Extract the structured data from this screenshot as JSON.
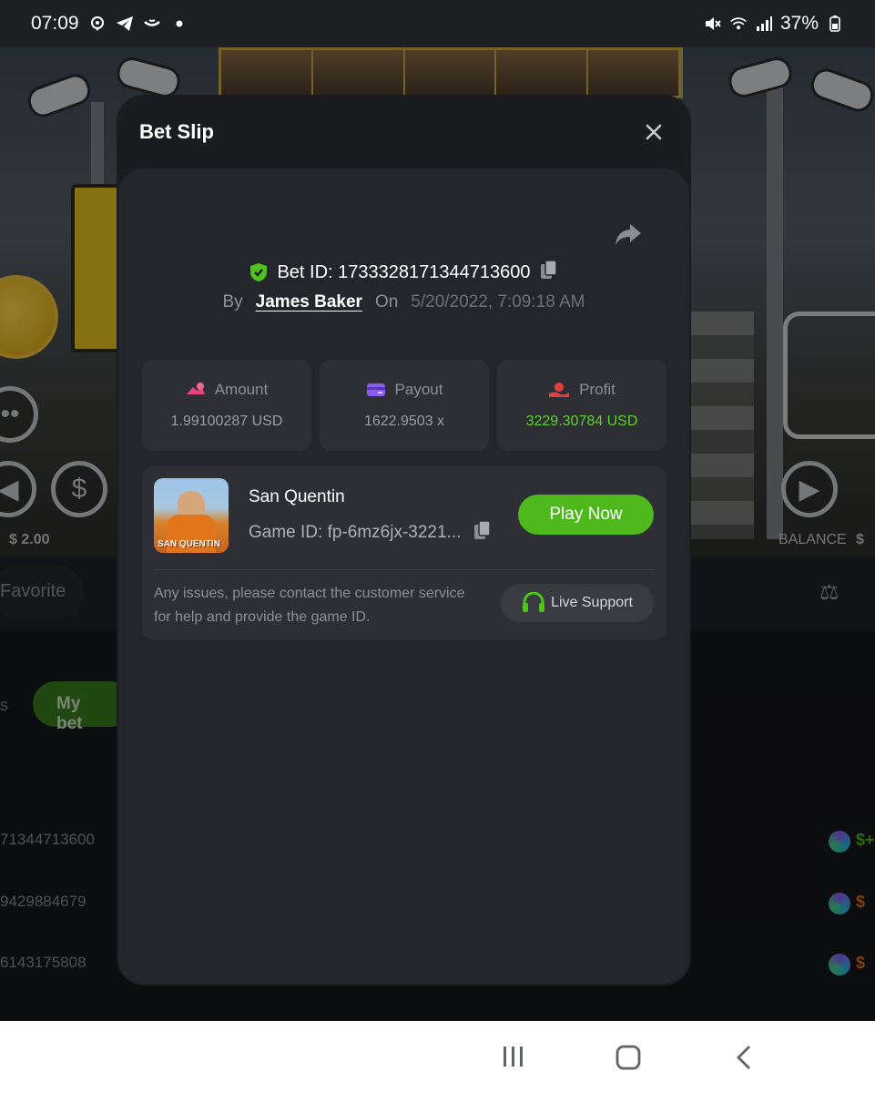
{
  "status_bar": {
    "time": "07:09",
    "battery": "37%"
  },
  "background": {
    "bet_amount": "$ 2.00",
    "balance_label": "BALANCE",
    "balance_value": "$",
    "favorite_label": "Favorite",
    "my_bet_label": "My bet",
    "tab_partial": "s",
    "rows": [
      {
        "id": "71344713600",
        "amount": "$+"
      },
      {
        "id": "9429884679",
        "amount": "$"
      },
      {
        "id": "6143175808",
        "amount": "$"
      }
    ],
    "colors": {
      "positive": "#4fb81c",
      "negative": "#e06a1c"
    }
  },
  "modal": {
    "title": "Bet Slip",
    "bet_id_label": "Bet ID:",
    "bet_id": "1733328171344713600",
    "by_label": "By",
    "user": "James Baker",
    "on_label": "On",
    "date": "5/20/2022, 7:09:18 AM",
    "stats": [
      {
        "label": "Amount",
        "value": "1.99100287 USD",
        "icon": "amount-icon",
        "icon_color": "#e8437a"
      },
      {
        "label": "Payout",
        "value": "1622.9503 x",
        "icon": "card-icon",
        "icon_color": "#8b5cf0"
      },
      {
        "label": "Profit",
        "value": "3229.30784 USD",
        "icon": "profit-icon",
        "icon_color": "#e0403c"
      }
    ],
    "game": {
      "name": "San Quentin",
      "id_label": "Game ID:",
      "id_value": "fp-6mz6jx-3221...",
      "thumb_text": "SAN QUENTIN",
      "play_label": "Play Now"
    },
    "support_text": "Any issues, please contact the customer service for help and provide the game ID.",
    "live_support_label": "Live Support",
    "colors": {
      "accent": "#4fb81c",
      "profit": "#5cd12a"
    }
  }
}
